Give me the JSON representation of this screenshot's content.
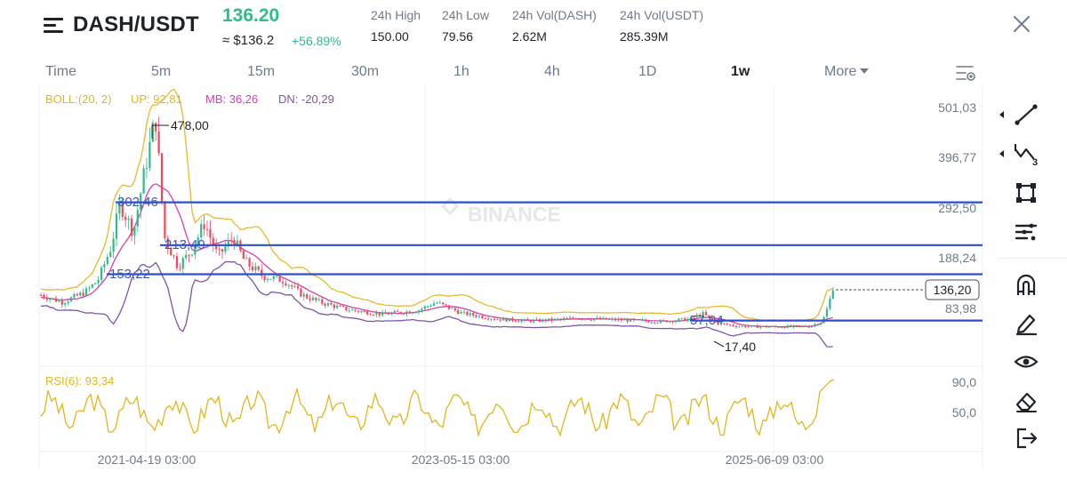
{
  "header": {
    "pair": "DASH/USDT",
    "price": "136.20",
    "usd_price": "≈ $136.2",
    "change": "+56.89%",
    "stats": [
      {
        "label": "24h High",
        "value": "150.00"
      },
      {
        "label": "24h Low",
        "value": "79.56"
      },
      {
        "label": "24h Vol(DASH)",
        "value": "2.62M"
      },
      {
        "label": "24h Vol(USDT)",
        "value": "285.39M"
      }
    ]
  },
  "timeframes": {
    "items": [
      "Time",
      "5m",
      "15m",
      "30m",
      "1h",
      "4h",
      "1D",
      "1w"
    ],
    "active": "1w",
    "more": "More"
  },
  "indicators": {
    "boll": {
      "name": "BOLL:(20, 2)",
      "up": "UP: 92,81",
      "mb": "MB: 36,26",
      "dn": "DN: -20,29"
    },
    "rsi": "RSI(6): 93,34"
  },
  "watermark": "BINANCE",
  "price_axis": [
    "501,03",
    "396,77",
    "292,50",
    "188,24",
    "83,98"
  ],
  "current_price_tag": "136,20",
  "rsi_axis": [
    "90,0",
    "50,0"
  ],
  "x_axis": [
    "2021-04-19 03:00",
    "2023-05-15 03:00",
    "2025-06-09 03:00"
  ],
  "annotations": {
    "high": "478,00",
    "low": "17,40",
    "levels": [
      "302,46",
      "213,49",
      "153,22",
      "57,04"
    ]
  },
  "colors": {
    "up": "#2ebd85",
    "down": "#f6465d",
    "boll_up": "#e8b92e",
    "boll_mb": "#d63fa7",
    "boll_dn": "#7d56a8",
    "level_line": "#2b4fcf",
    "rsi": "#e2b620"
  },
  "tools": [
    "line-tool-icon",
    "fib-tool-icon",
    "shape-tool-icon",
    "list-tool-icon",
    "magnet-icon",
    "pencil-icon",
    "eye-icon",
    "eraser-icon",
    "exit-icon"
  ]
}
